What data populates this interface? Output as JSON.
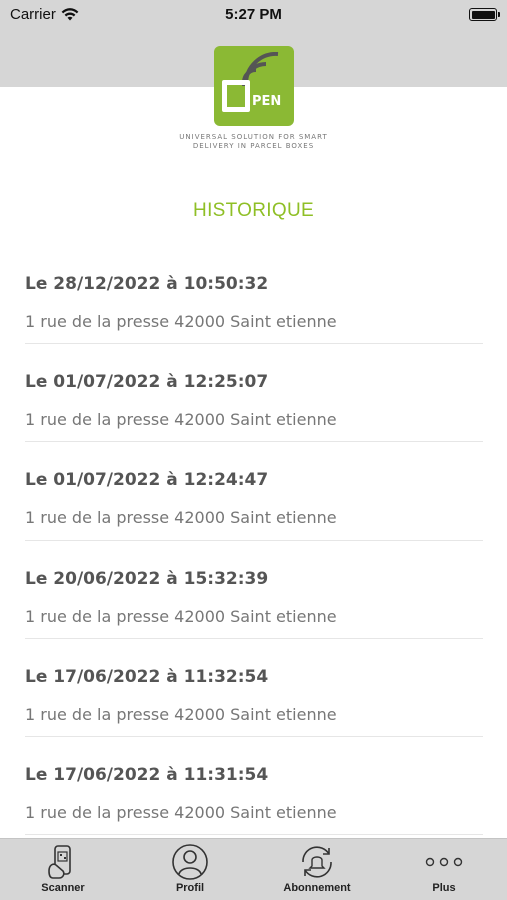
{
  "status_bar": {
    "carrier": "Carrier",
    "time": "5:27 PM"
  },
  "logo": {
    "text": "PEN",
    "tagline_line1": "UNIVERSAL SOLUTION FOR SMART",
    "tagline_line2": "DELIVERY IN PARCEL BOXES"
  },
  "page": {
    "title": "HISTORIQUE"
  },
  "history": [
    {
      "date": "Le 28/12/2022 à 10:50:32",
      "address": "1 rue de la presse 42000 Saint etienne"
    },
    {
      "date": "Le 01/07/2022 à 12:25:07",
      "address": "1 rue de la presse 42000 Saint etienne"
    },
    {
      "date": "Le 01/07/2022 à 12:24:47",
      "address": "1 rue de la presse 42000 Saint etienne"
    },
    {
      "date": "Le 20/06/2022 à 15:32:39",
      "address": "1 rue de la presse 42000 Saint etienne"
    },
    {
      "date": "Le 17/06/2022 à 11:32:54",
      "address": "1 rue de la presse 42000 Saint etienne"
    },
    {
      "date": "Le 17/06/2022 à 11:31:54",
      "address": "1 rue de la presse 42000 Saint etienne"
    }
  ],
  "tabs": [
    {
      "label": "Scanner",
      "icon": "scanner-icon"
    },
    {
      "label": "Profil",
      "icon": "profile-icon"
    },
    {
      "label": "Abonnement",
      "icon": "subscription-icon"
    },
    {
      "label": "Plus",
      "icon": "more-icon"
    }
  ],
  "colors": {
    "accent": "#8fbf26",
    "logo_bg": "#8bb934",
    "bar_bg": "#d6d6d6"
  }
}
